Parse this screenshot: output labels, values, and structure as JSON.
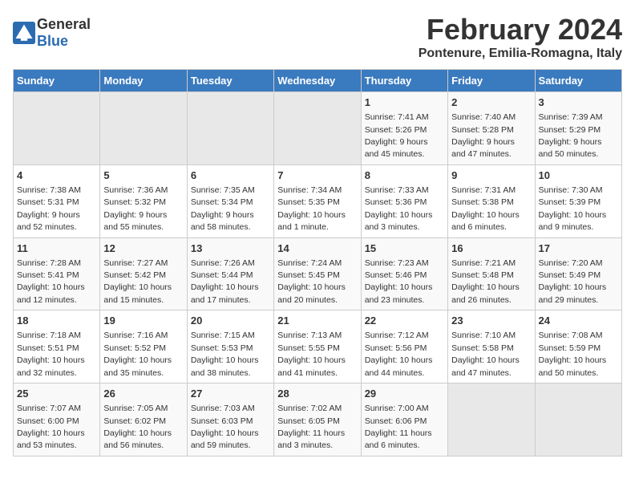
{
  "header": {
    "logo_general": "General",
    "logo_blue": "Blue",
    "title": "February 2024",
    "subtitle": "Pontenure, Emilia-Romagna, Italy"
  },
  "days_of_week": [
    "Sunday",
    "Monday",
    "Tuesday",
    "Wednesday",
    "Thursday",
    "Friday",
    "Saturday"
  ],
  "weeks": [
    [
      {
        "day": "",
        "info": ""
      },
      {
        "day": "",
        "info": ""
      },
      {
        "day": "",
        "info": ""
      },
      {
        "day": "",
        "info": ""
      },
      {
        "day": "1",
        "info": "Sunrise: 7:41 AM\nSunset: 5:26 PM\nDaylight: 9 hours\nand 45 minutes."
      },
      {
        "day": "2",
        "info": "Sunrise: 7:40 AM\nSunset: 5:28 PM\nDaylight: 9 hours\nand 47 minutes."
      },
      {
        "day": "3",
        "info": "Sunrise: 7:39 AM\nSunset: 5:29 PM\nDaylight: 9 hours\nand 50 minutes."
      }
    ],
    [
      {
        "day": "4",
        "info": "Sunrise: 7:38 AM\nSunset: 5:31 PM\nDaylight: 9 hours\nand 52 minutes."
      },
      {
        "day": "5",
        "info": "Sunrise: 7:36 AM\nSunset: 5:32 PM\nDaylight: 9 hours\nand 55 minutes."
      },
      {
        "day": "6",
        "info": "Sunrise: 7:35 AM\nSunset: 5:34 PM\nDaylight: 9 hours\nand 58 minutes."
      },
      {
        "day": "7",
        "info": "Sunrise: 7:34 AM\nSunset: 5:35 PM\nDaylight: 10 hours\nand 1 minute."
      },
      {
        "day": "8",
        "info": "Sunrise: 7:33 AM\nSunset: 5:36 PM\nDaylight: 10 hours\nand 3 minutes."
      },
      {
        "day": "9",
        "info": "Sunrise: 7:31 AM\nSunset: 5:38 PM\nDaylight: 10 hours\nand 6 minutes."
      },
      {
        "day": "10",
        "info": "Sunrise: 7:30 AM\nSunset: 5:39 PM\nDaylight: 10 hours\nand 9 minutes."
      }
    ],
    [
      {
        "day": "11",
        "info": "Sunrise: 7:28 AM\nSunset: 5:41 PM\nDaylight: 10 hours\nand 12 minutes."
      },
      {
        "day": "12",
        "info": "Sunrise: 7:27 AM\nSunset: 5:42 PM\nDaylight: 10 hours\nand 15 minutes."
      },
      {
        "day": "13",
        "info": "Sunrise: 7:26 AM\nSunset: 5:44 PM\nDaylight: 10 hours\nand 17 minutes."
      },
      {
        "day": "14",
        "info": "Sunrise: 7:24 AM\nSunset: 5:45 PM\nDaylight: 10 hours\nand 20 minutes."
      },
      {
        "day": "15",
        "info": "Sunrise: 7:23 AM\nSunset: 5:46 PM\nDaylight: 10 hours\nand 23 minutes."
      },
      {
        "day": "16",
        "info": "Sunrise: 7:21 AM\nSunset: 5:48 PM\nDaylight: 10 hours\nand 26 minutes."
      },
      {
        "day": "17",
        "info": "Sunrise: 7:20 AM\nSunset: 5:49 PM\nDaylight: 10 hours\nand 29 minutes."
      }
    ],
    [
      {
        "day": "18",
        "info": "Sunrise: 7:18 AM\nSunset: 5:51 PM\nDaylight: 10 hours\nand 32 minutes."
      },
      {
        "day": "19",
        "info": "Sunrise: 7:16 AM\nSunset: 5:52 PM\nDaylight: 10 hours\nand 35 minutes."
      },
      {
        "day": "20",
        "info": "Sunrise: 7:15 AM\nSunset: 5:53 PM\nDaylight: 10 hours\nand 38 minutes."
      },
      {
        "day": "21",
        "info": "Sunrise: 7:13 AM\nSunset: 5:55 PM\nDaylight: 10 hours\nand 41 minutes."
      },
      {
        "day": "22",
        "info": "Sunrise: 7:12 AM\nSunset: 5:56 PM\nDaylight: 10 hours\nand 44 minutes."
      },
      {
        "day": "23",
        "info": "Sunrise: 7:10 AM\nSunset: 5:58 PM\nDaylight: 10 hours\nand 47 minutes."
      },
      {
        "day": "24",
        "info": "Sunrise: 7:08 AM\nSunset: 5:59 PM\nDaylight: 10 hours\nand 50 minutes."
      }
    ],
    [
      {
        "day": "25",
        "info": "Sunrise: 7:07 AM\nSunset: 6:00 PM\nDaylight: 10 hours\nand 53 minutes."
      },
      {
        "day": "26",
        "info": "Sunrise: 7:05 AM\nSunset: 6:02 PM\nDaylight: 10 hours\nand 56 minutes."
      },
      {
        "day": "27",
        "info": "Sunrise: 7:03 AM\nSunset: 6:03 PM\nDaylight: 10 hours\nand 59 minutes."
      },
      {
        "day": "28",
        "info": "Sunrise: 7:02 AM\nSunset: 6:05 PM\nDaylight: 11 hours\nand 3 minutes."
      },
      {
        "day": "29",
        "info": "Sunrise: 7:00 AM\nSunset: 6:06 PM\nDaylight: 11 hours\nand 6 minutes."
      },
      {
        "day": "",
        "info": ""
      },
      {
        "day": "",
        "info": ""
      }
    ]
  ]
}
